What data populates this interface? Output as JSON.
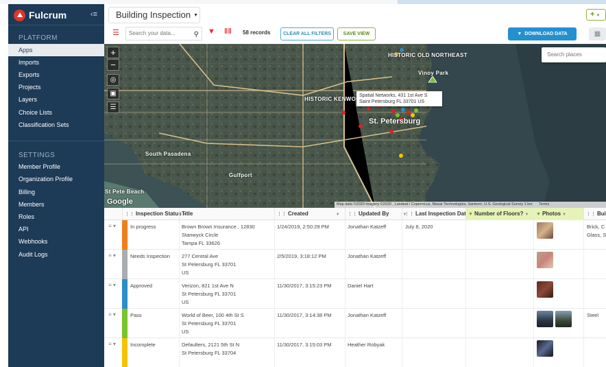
{
  "app": {
    "brand": "Fulcrum",
    "collapse_icon": "collapse-sidebar-icon"
  },
  "sidebar": {
    "platform_title": "PLATFORM",
    "platform_items": [
      {
        "label": "Apps",
        "active": true
      },
      {
        "label": "Imports"
      },
      {
        "label": "Exports"
      },
      {
        "label": "Projects"
      },
      {
        "label": "Layers"
      },
      {
        "label": "Choice Lists"
      },
      {
        "label": "Classification Sets"
      }
    ],
    "settings_title": "SETTINGS",
    "settings_items": [
      {
        "label": "Member Profile"
      },
      {
        "label": "Organization Profile"
      },
      {
        "label": "Billing"
      },
      {
        "label": "Members"
      },
      {
        "label": "Roles"
      },
      {
        "label": "API"
      },
      {
        "label": "Webhooks"
      },
      {
        "label": "Audit Logs"
      }
    ]
  },
  "header": {
    "app_title": "Building Inspection",
    "add_label": "+"
  },
  "toolbar": {
    "search_placeholder": "Search your data...",
    "records": "58 records",
    "clear_filters": "CLEAR ALL FILTERS",
    "save_view": "SAVE VIEW",
    "download": "DOWNLOAD DATA"
  },
  "map": {
    "search_places_placeholder": "Search places",
    "popup_line1": "Spatial Networks, 431 1st Ave S",
    "popup_line2": "Saint Petersburg FL 33701 US",
    "labels": {
      "historic_old_northeast": "HISTORIC OLD NORTHEAST",
      "historic_kenwood": "HISTORIC KENWOOD",
      "st_petersburg": "St. Petersburg",
      "vinoy_park": "Vinoy Park",
      "south_pasadena": "South Pasadena",
      "gulfport": "Gulfport",
      "st_pete_beach": "St Pete Beach"
    },
    "google": "Google",
    "attribution": "Map data ©2020 Imagery ©2020 , Landsat / Copernicus, Maxar Technologies, Sanborn, U.S. Geological Survey   1 km",
    "terms": "Terms",
    "colors": {
      "marker_red": "#d7261e",
      "marker_green": "#7ac231",
      "marker_blue": "#2d8ec2",
      "marker_yellow": "#f5c400"
    }
  },
  "table": {
    "columns": [
      {
        "label": "Inspection Status"
      },
      {
        "label": "Title"
      },
      {
        "label": "Created"
      },
      {
        "label": "Updated By"
      },
      {
        "label": "Last Inspection Date"
      },
      {
        "label": "Number of Floors?"
      },
      {
        "label": "Photos"
      },
      {
        "label": "Building"
      }
    ],
    "rows": [
      {
        "status": "In progress",
        "status_color": "#f07f1b",
        "title1": "Brown Brown Insurance , 12830",
        "title2": "Stanwyck Circle",
        "title3": "Tampa FL 33626",
        "created": "1/24/2019, 2:50:29 PM",
        "updated_by": "Jonathan Katzeff",
        "last_inspection": "July 8, 2020",
        "building1": "Brick, C",
        "building2": "Glass, S"
      },
      {
        "status": "Needs Inspection",
        "status_color": "#a9adb1",
        "title1": "277 Central Ave",
        "title2": "St Petersburg FL 33701",
        "title3": "US",
        "created": "2/5/2019, 3:18:12 PM",
        "updated_by": "Jonathan Katzeff",
        "last_inspection": "",
        "building1": "",
        "building2": ""
      },
      {
        "status": "Approved",
        "status_color": "#2a8fc8",
        "title1": "Verizon, 821 1st Ave N",
        "title2": "St Petersburg FL 33701",
        "title3": "US",
        "created": "11/30/2017, 3:15:23 PM",
        "updated_by": "Daniel Hart",
        "last_inspection": "",
        "building1": "",
        "building2": ""
      },
      {
        "status": "Pass",
        "status_color": "#78c42b",
        "title1": "World of Beer, 100 4th St S",
        "title2": "St Petersburg FL 33701",
        "title3": "US",
        "created": "11/30/2017, 3:14:38 PM",
        "updated_by": "Jonathan Katzeff",
        "last_inspection": "",
        "building1": "Steel",
        "building2": ""
      },
      {
        "status": "Incomplete",
        "status_color": "#f5c400",
        "title1": "Defaulters, 2121 5th St N",
        "title2": "St Petersburg FL 33704",
        "title3": "",
        "created": "11/30/2017, 3:15:03 PM",
        "updated_by": "Heather Robyak",
        "last_inspection": "",
        "building1": "",
        "building2": ""
      }
    ]
  }
}
